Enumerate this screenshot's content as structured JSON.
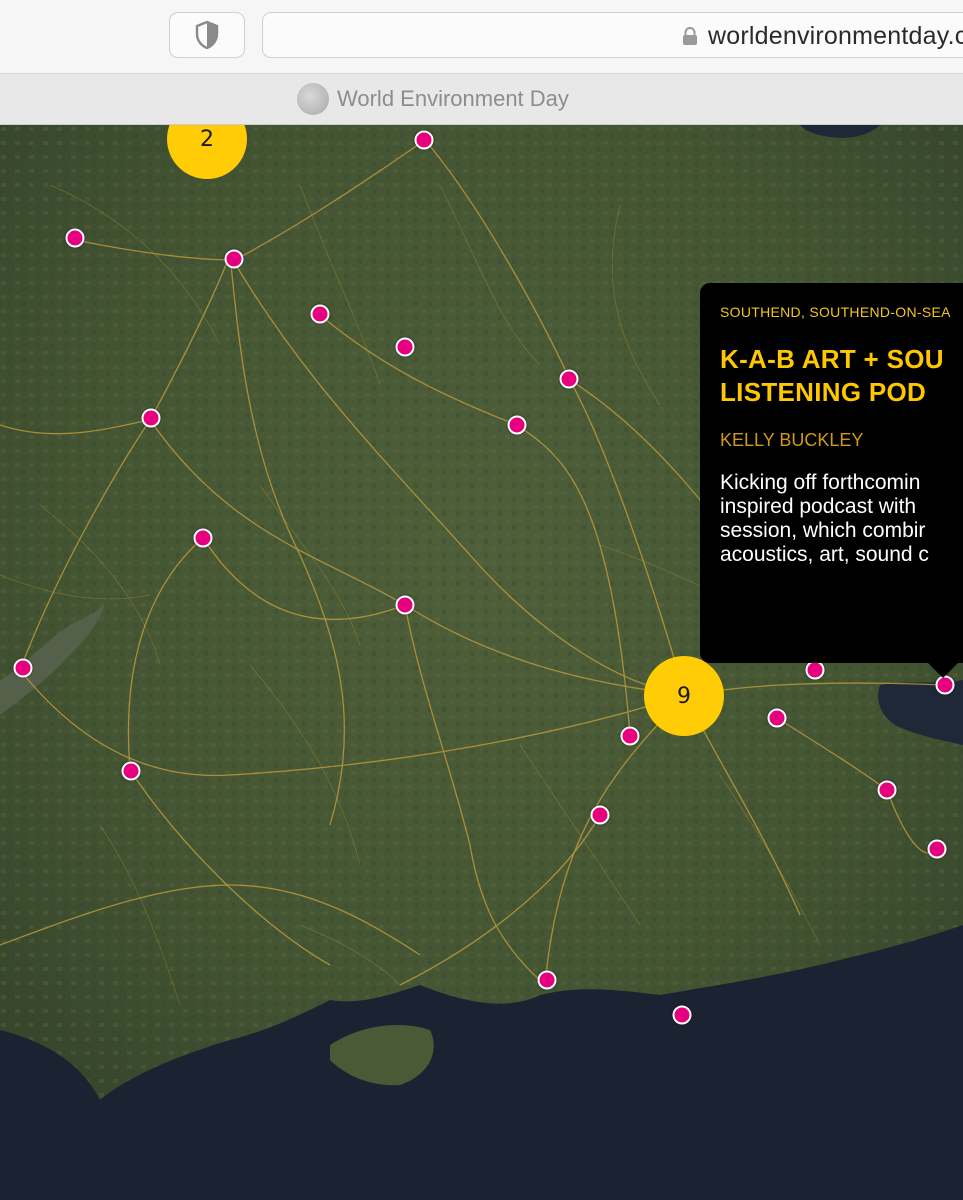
{
  "browser": {
    "url": "worldenvironmentday.c",
    "tab_title": "World Environment Day"
  },
  "map": {
    "clusters": [
      {
        "count": "2"
      },
      {
        "count": "9"
      }
    ]
  },
  "popup": {
    "location": "SOUTHEND, SOUTHEND-ON-SEA",
    "title_lines": [
      "K-A-B ART + SOU",
      "LISTENING POD"
    ],
    "author": "KELLY BUCKLEY",
    "description_lines": [
      "Kicking off forthcomin",
      "inspired podcast with",
      "session, which combir",
      "acoustics, art, sound c"
    ]
  },
  "colors": {
    "pin": "#e6007e",
    "cluster": "#ffcc05",
    "popup_bg": "#000000",
    "popup_accent": "#ffc700",
    "land": "#465634",
    "sea": "#1b2231",
    "roads": "#c9a23c"
  },
  "icons": {
    "shield": "shield-icon",
    "lock": "lock-icon",
    "favicon": "globe-icon"
  }
}
